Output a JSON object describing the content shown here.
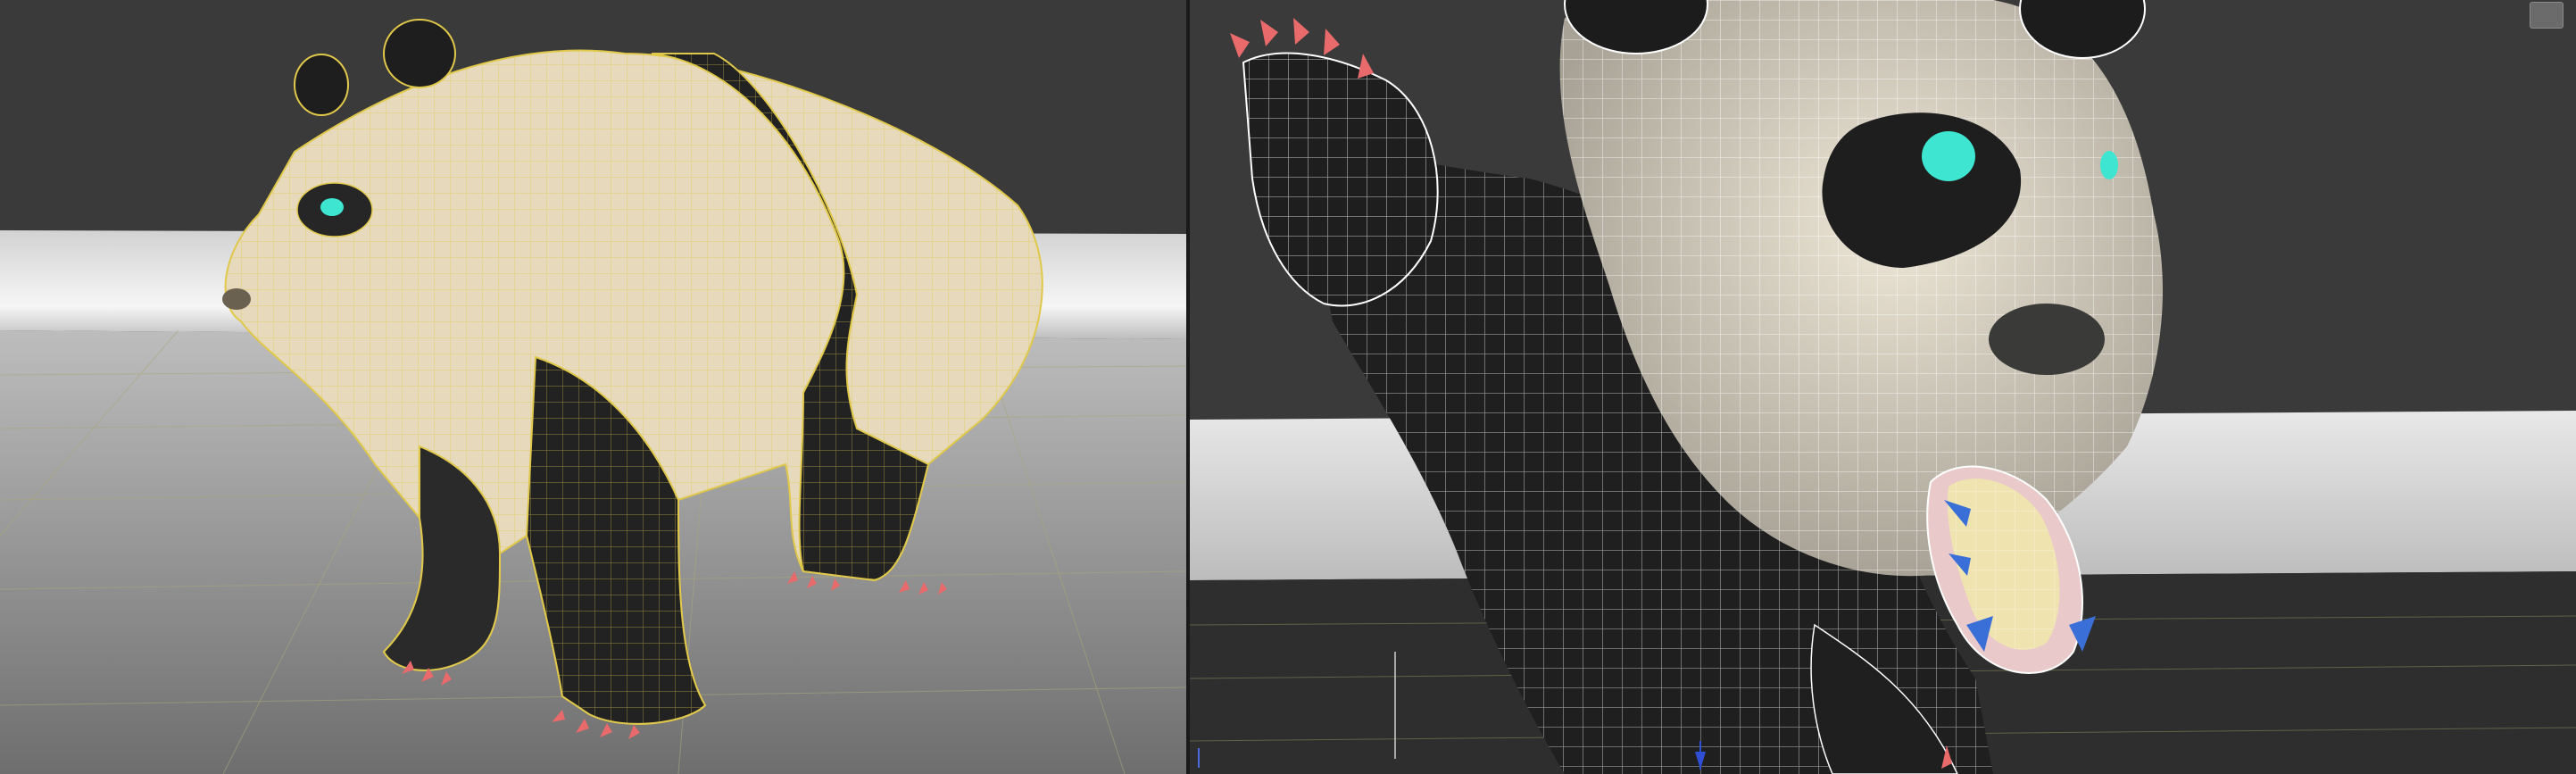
{
  "viewports": {
    "left": {
      "name": "perspective-viewport-left",
      "label": ""
    },
    "right": {
      "name": "perspective-viewport-right",
      "label": "",
      "nav_cube_label": ""
    }
  },
  "colors": {
    "background": "#3a3a3a",
    "floor": "#8a8a8a",
    "wall": "#e4e4e4",
    "wireframe_selected": "#e0c84a",
    "wireframe_white": "#ffffff",
    "panda_white": "#e8dcc0",
    "panda_black": "#222222",
    "claw": "#e86a6a",
    "eye": "#3ee6d2",
    "teeth": "#3a6fd8",
    "tongue": "#efe4b0"
  },
  "icons": [
    "axis-gizmo-icon",
    "view-cube-icon"
  ]
}
